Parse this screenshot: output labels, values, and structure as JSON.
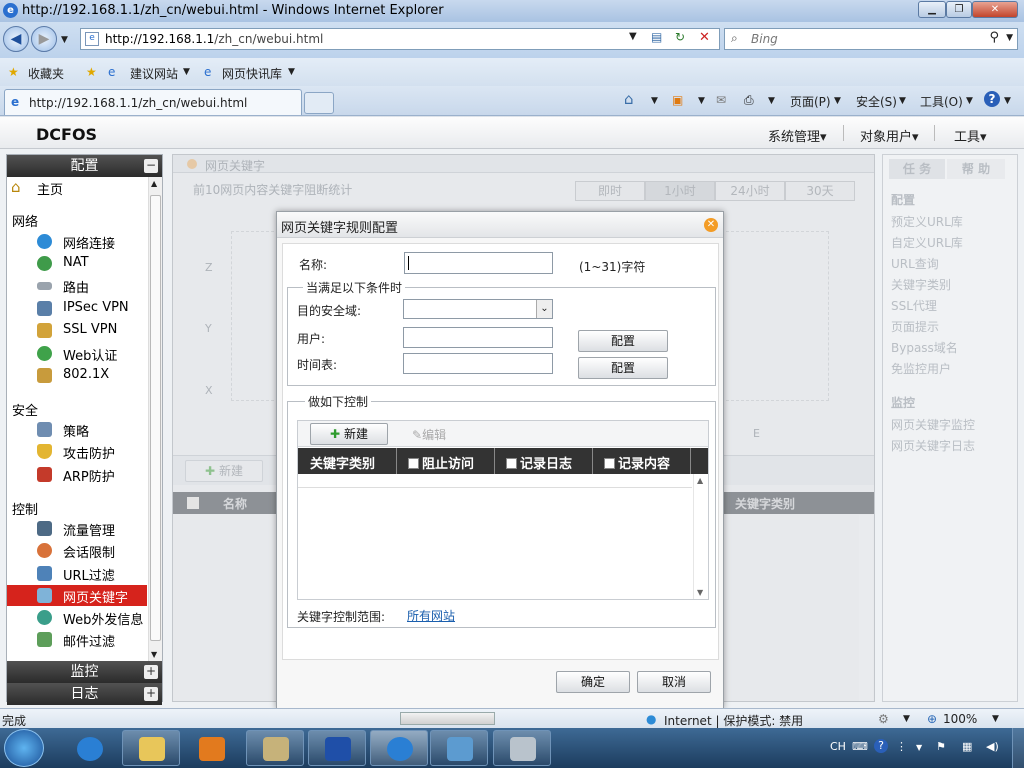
{
  "browser": {
    "title": "http://192.168.1.1/zh_cn/webui.html - Windows Internet Explorer",
    "url_prefix": "http://192.168.1.1",
    "url_suffix": "/zh_cn/webui.html",
    "search_placeholder": "Bing",
    "tab_title": "http://192.168.1.1/zh_cn/webui.html",
    "favorites": "收藏夹",
    "fav_suggested": "建议网站",
    "fav_gallery": "网页快讯库",
    "cmd_page": "页面(P)",
    "cmd_safety": "安全(S)",
    "cmd_tools": "工具(O)",
    "status": "完成",
    "zone": "Internet | 保护模式: 禁用",
    "zoom": "100%"
  },
  "app": {
    "logo": "DCFOS",
    "menu": [
      "系统管理",
      "对象用户",
      "工具"
    ]
  },
  "sidebar": {
    "config_title": "配置",
    "home": "主页",
    "sections": [
      {
        "title": "网络",
        "items": [
          "网络连接",
          "NAT",
          "路由",
          "IPSec VPN",
          "SSL VPN",
          "Web认证",
          "802.1X"
        ]
      },
      {
        "title": "安全",
        "items": [
          "策略",
          "攻击防护",
          "ARP防护"
        ]
      },
      {
        "title": "控制",
        "items": [
          "流量管理",
          "会话限制",
          "URL过滤",
          "网页关键字",
          "Web外发信息",
          "邮件过滤"
        ]
      }
    ],
    "active": "网页关键字",
    "monitor": "监控",
    "log": "日志"
  },
  "main": {
    "breadcrumb": "网页关键字",
    "subtitle": "前10网页内容关键字阻断统计",
    "timebtns": [
      "即时",
      "1小时",
      "24小时",
      "30天"
    ],
    "axis_z": "Z",
    "axis_y": "Y",
    "axis_x": "X",
    "axis_e": "E",
    "new": "新建",
    "col_name": "名称",
    "col_kwtype": "关键字类别"
  },
  "rpanel": {
    "tab_task": "任 务",
    "tab_help": "帮 助",
    "config": "配置",
    "links": [
      "预定义URL库",
      "自定义URL库",
      "URL查询",
      "关键字类别",
      "SSL代理",
      "页面提示",
      "Bypass域名",
      "免监控用户"
    ],
    "monitor": "监控",
    "mlinks": [
      "网页关键字监控",
      "网页关键字日志"
    ]
  },
  "dialog": {
    "title": "网页关键字规则配置",
    "name_label": "名称:",
    "name_value": "",
    "name_hint": "(1~31)字符",
    "cond_legend": "当满足以下条件时",
    "zone_label": "目的安全域:",
    "user_label": "用户:",
    "schedule_label": "时间表:",
    "config_btn": "配置",
    "ctrl_legend": "做如下控制",
    "new_btn": "新建",
    "edit_btn": "编辑",
    "col_kwtype": "关键字类别",
    "col_block": "阻止访问",
    "col_log": "记录日志",
    "col_content": "记录内容",
    "scope_label": "关键字控制范围:",
    "scope_link": "所有网站",
    "ok": "确定",
    "cancel": "取消"
  },
  "taskbar": {
    "lang": "CH"
  }
}
